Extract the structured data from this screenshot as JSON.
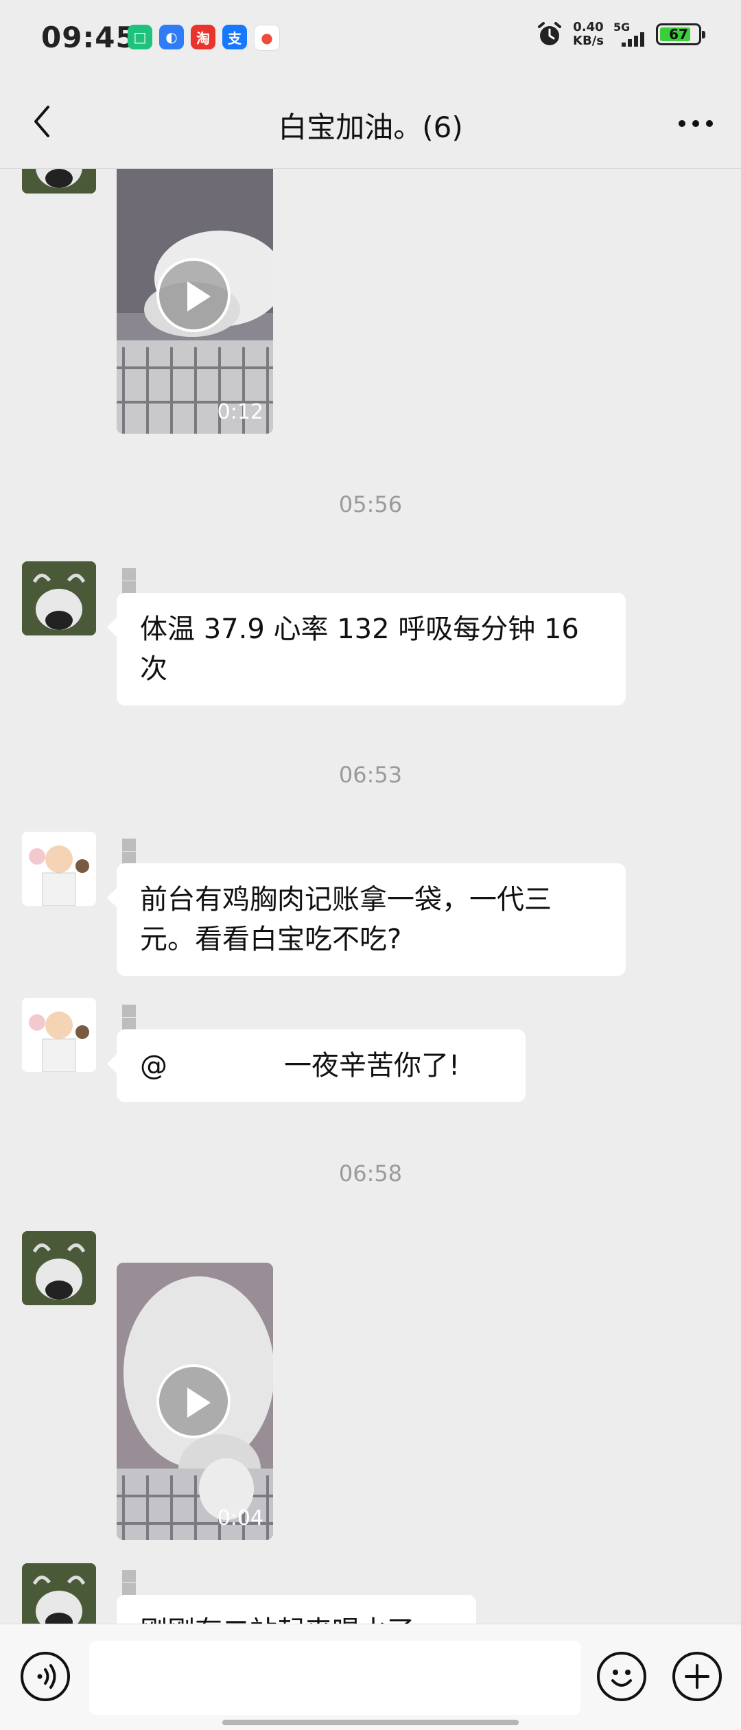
{
  "status_bar": {
    "time": "09:45",
    "notifications": [
      {
        "icon": "xiaomi-app-icon",
        "glyph": "□",
        "color": "#1ec27a"
      },
      {
        "icon": "baidu-app-icon",
        "glyph": "◐",
        "color": "#2f7cf6"
      },
      {
        "icon": "taobao-app-icon",
        "glyph": "淘",
        "color": "#e8342c"
      },
      {
        "icon": "alipay-app-icon",
        "glyph": "支",
        "color": "#1677ff"
      },
      {
        "icon": "map-app-icon",
        "glyph": "●",
        "color": "#f04a3a"
      }
    ],
    "net_speed_value": "0.40",
    "net_speed_unit": "KB/s",
    "network_type": "5G",
    "battery": "67"
  },
  "header": {
    "title": "白宝加油。(6)"
  },
  "messages": {
    "video1_duration": "0:12",
    "time1": "05:56",
    "msg1_text": "体温 37.9 心率 132 呼吸每分钟 16 次",
    "time2": "06:53",
    "msg2_text": "前台有鸡胸肉记账拿一袋，一代三元。看看白宝吃不吃?",
    "msg3_prefix": "@",
    "msg3_text": "一夜辛苦你了!",
    "time3": "06:58",
    "video2_duration": "0:04",
    "msg4_text": "刚刚有二站起来喝水了"
  },
  "colors": {
    "background": "#ededed",
    "bubble": "#ffffff",
    "timestamp": "#9a9a9a"
  }
}
